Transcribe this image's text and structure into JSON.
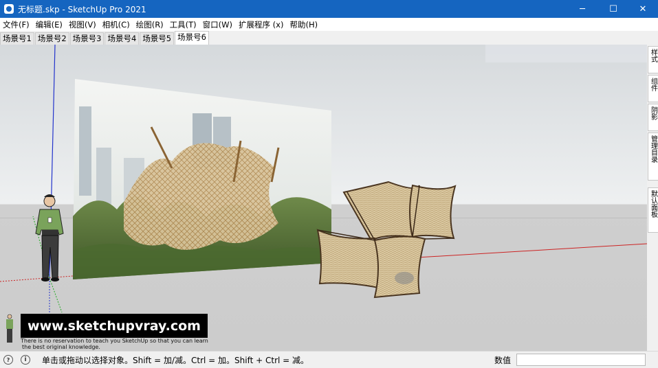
{
  "window": {
    "title": "无标题.skp - SketchUp Pro 2021",
    "minimize_glyph": "─",
    "maximize_glyph": "☐",
    "close_glyph": "✕"
  },
  "menu": [
    "文件(F)",
    "编辑(E)",
    "视图(V)",
    "相机(C)",
    "绘图(R)",
    "工具(T)",
    "窗口(W)",
    "扩展程序 (x)",
    "帮助(H)"
  ],
  "scene_tabs": [
    "场景号1",
    "场景号2",
    "场景号3",
    "场景号4",
    "场景号5",
    "场景号6"
  ],
  "active_scene_index": 5,
  "tray_tabs": [
    "样式",
    "组件",
    "阴影",
    "管理目录",
    "默认面板"
  ],
  "watermark": {
    "url": "www.sketchupvray.com",
    "line1": "There is no reservation to teach you SketchUp so that you can learn",
    "line2": "the best original knowledge."
  },
  "status": {
    "hint": "单击或拖动以选择对象。Shift = 加/减。Ctrl = 加。Shift + Ctrl = 减。",
    "measure_label": "数值",
    "measure_value": ""
  },
  "colors": {
    "titlebar": "#1565c0",
    "axis_blue": "#2233cc",
    "axis_red": "#cc2222",
    "axis_green": "#22aa22"
  }
}
